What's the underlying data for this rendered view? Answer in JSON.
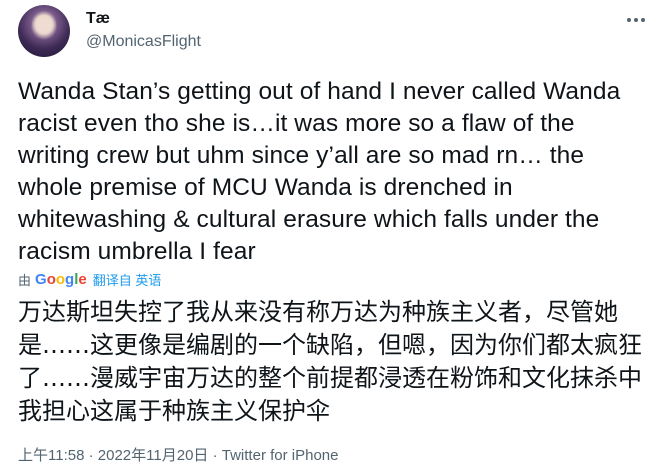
{
  "author": {
    "display_name": "Tæ",
    "handle": "@MonicasFlight",
    "avatar_icon": "profile-avatar"
  },
  "tweet": {
    "text": "Wanda Stan’s getting out of hand I never called Wanda\nracist even tho she is…it was more so a flaw of the\nwriting crew but uhm since y’all are so mad rn… the\nwhole premise of MCU Wanda is drenched in\nwhitewashing & cultural erasure which falls under the\nracism umbrella I fear"
  },
  "translation": {
    "by_label": "由",
    "provider": "Google",
    "link_label": "翻译自 英语",
    "text": "万达斯坦失控了我从来没有称万达为种族主义者，尽管她是……这更像是编剧的一个缺陷，但嗯，因为你们都太疯狂了……漫威宇宙万达的整个前提都浸透在粉饰和文化抹杀中我担心这属于种族主义保护伞"
  },
  "meta": {
    "time": "上午11:58",
    "separator1": " · ",
    "date": "2022年11月20日",
    "separator2": " · ",
    "source": "Twitter for iPhone"
  },
  "colors": {
    "text_primary": "#0f1419",
    "text_secondary": "#536471",
    "link": "#1d9bf0"
  }
}
